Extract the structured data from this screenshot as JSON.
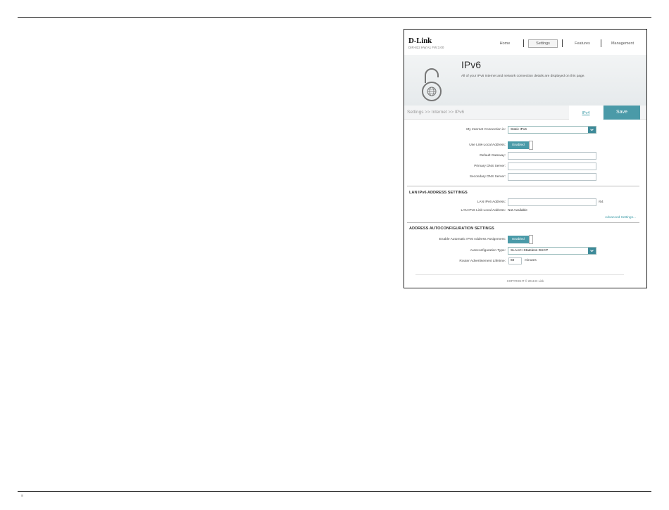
{
  "header": {
    "logo": "D-Link",
    "model": "DIR-822 HW:A1 FW:3.00",
    "nav": [
      {
        "label": "Home"
      },
      {
        "label": "Settings"
      },
      {
        "label": "Features"
      },
      {
        "label": "Management"
      }
    ],
    "active_nav": "Settings"
  },
  "banner": {
    "title": "IPv6",
    "description": "All of your IPv6 Internet and network connection details are displayed on this page."
  },
  "breadcrumb": "Settings >> Internet >> IPv6",
  "tabs": {
    "ipv4": "IPv4",
    "save": "Save"
  },
  "form": {
    "connection_label": "My Internet Connection is:",
    "connection_value": "Static IPv6",
    "link_local_label": "Use Link-Local Address:",
    "link_local_value": "Enabled",
    "gateway_label": "Default Gateway:",
    "gateway_value": "",
    "primary_dns_label": "Primary DNS Server:",
    "primary_dns_value": "",
    "secondary_dns_label": "Secondary DNS Server:",
    "secondary_dns_value": ""
  },
  "lan": {
    "section_title": "LAN IPv6 ADDRESS SETTINGS",
    "address_label": "LAN IPv6 Address:",
    "address_value": "",
    "prefix_suffix": "/64",
    "link_local_label": "LAN IPv6 Link-Local Address:",
    "link_local_value": "Not Available",
    "advanced_link": "Advanced Settings..."
  },
  "autoconfig": {
    "section_title": "ADDRESS AUTOCONFIGURATION SETTINGS",
    "enable_label": "Enable Automatic IPv6 Address Assignment:",
    "enable_value": "Enabled",
    "type_label": "Autoconfiguration Type:",
    "type_value": "SLAAC+Stateless DHCP",
    "lifetime_label": "Router Advertisement Lifetime:",
    "lifetime_value": "60",
    "lifetime_unit": "minutes"
  },
  "footer": "COPYRIGHT © 2016 D-Link",
  "colors": {
    "accent": "#4a9aa8",
    "link": "#3a9aa6"
  }
}
